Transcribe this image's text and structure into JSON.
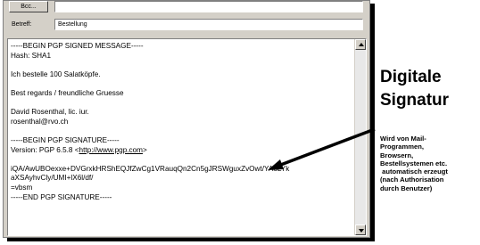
{
  "header": {
    "bcc_button": "Bcc...",
    "subject_label": "Betreff:",
    "subject_value": "Bestellung"
  },
  "message": {
    "lines": [
      "-----BEGIN PGP SIGNED MESSAGE-----",
      "Hash: SHA1",
      "",
      "Ich bestelle 100 Salatköpfe.",
      "",
      "Best regards / freundliche Gruesse",
      "",
      "David Rosenthal, lic. iur.",
      "rosenthal@rvo.ch",
      "",
      "-----BEGIN PGP SIGNATURE-----",
      "Version: PGP 6.5.8 <http://www.pgp.com>",
      "",
      "iQA/AwUBOexxe+DVGrxkHRShEQJfZwCg1VRauqQn2Cn5gJRSWguxZvOwt/YAoLYk",
      "aXSAyhvCly/UMI+lX6l/df/",
      "=vbsm",
      "-----END PGP SIGNATURE-----"
    ]
  },
  "annotation": {
    "title_line1": "Digitale",
    "title_line2": "Signatur",
    "note_lines": [
      "Wird von Mail-",
      "Programmen,",
      "Browsern,",
      "Bestellsystemen etc.",
      " automatisch erzeugt",
      "(nach Authorisation",
      "durch Benutzer)"
    ]
  }
}
